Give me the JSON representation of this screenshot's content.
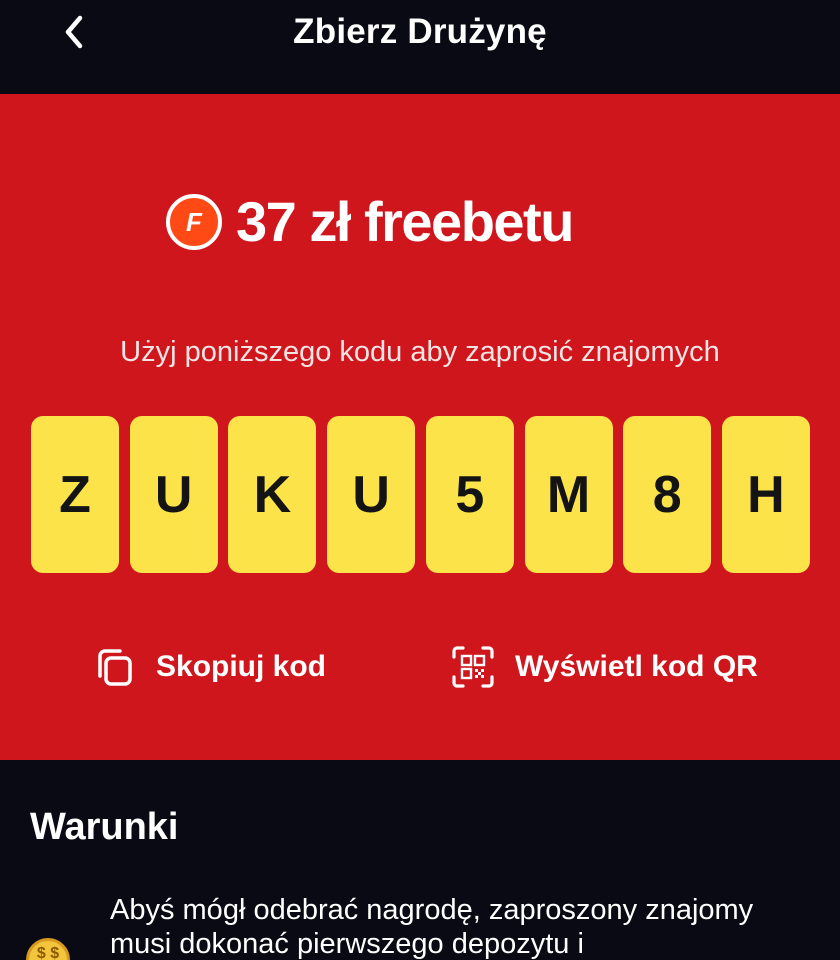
{
  "header": {
    "title": "Zbierz Drużynę",
    "back_icon": "chevron-left-icon"
  },
  "hero": {
    "badge_letter": "F",
    "headline": "37 zł freebetu",
    "subtitle": "Użyj poniższego kodu aby zaprosić znajomych",
    "code": [
      "Z",
      "U",
      "K",
      "U",
      "5",
      "M",
      "8",
      "H"
    ],
    "copy_label": "Skopiuj kod",
    "qr_label": "Wyświetl kod QR",
    "colors": {
      "background": "#cf161d",
      "tile": "#fde34a",
      "badge": "#ff4a16"
    }
  },
  "terms": {
    "title": "Warunki",
    "item_icon": "coin-icon",
    "item_text": "Abyś mógł odebrać nagrodę, zaproszony znajomy musi dokonać pierwszego depozytu i"
  }
}
